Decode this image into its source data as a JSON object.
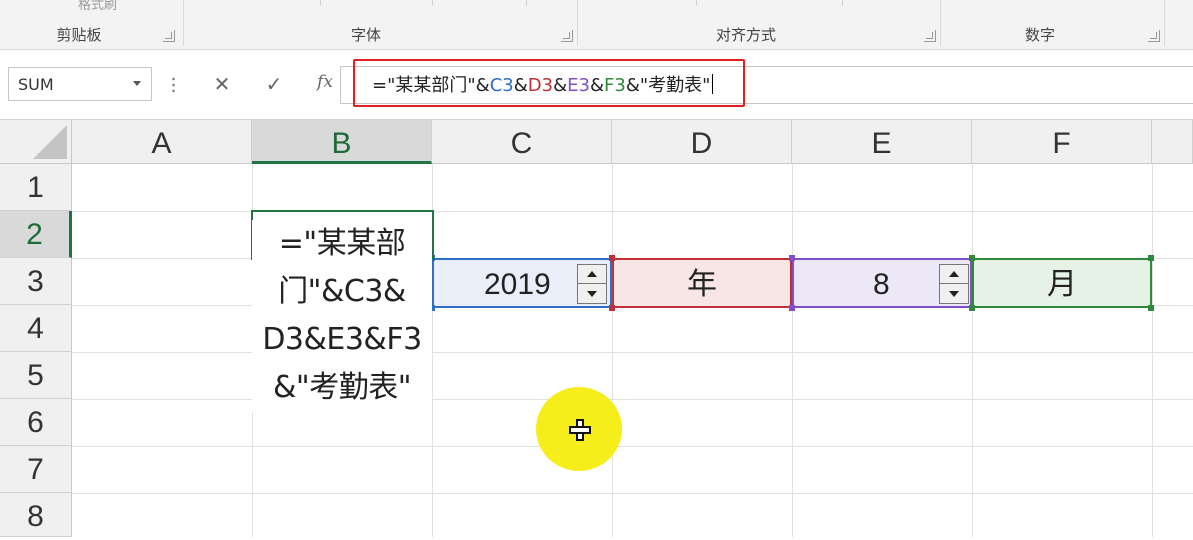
{
  "ribbon": {
    "clipboard_partial": "格式刷",
    "groups": [
      "剪贴板",
      "字体",
      "对齐方式",
      "数字"
    ]
  },
  "formula_bar": {
    "name_box": "SUM",
    "cancel_icon": "close-icon",
    "enter_icon": "checkmark-icon",
    "fx_label": "fx",
    "formula": {
      "p1": "=\"某某部门\"&",
      "c3": "C3",
      "amp1": "&",
      "d3": "D3",
      "amp2": "&",
      "e3": "E3",
      "amp3": "&",
      "f3": "F3",
      "p2": "&\"考勤表\""
    }
  },
  "grid": {
    "columns": [
      "A",
      "B",
      "C",
      "D",
      "E",
      "F"
    ],
    "rows": [
      "1",
      "2",
      "3",
      "4",
      "5",
      "6",
      "7",
      "8"
    ],
    "active_column": "B",
    "active_row": "2",
    "edit_cell_lines": [
      "=\"某某部",
      "门\"&C3&",
      "D3&E3&F3",
      "&\"考勤表\""
    ],
    "cells": {
      "C3": "2019",
      "D3": "年",
      "E3": "8",
      "F3": "月"
    },
    "ref_colors": {
      "C3": "#2e6fc7",
      "D3": "#c0303a",
      "E3": "#8050c8",
      "F3": "#2e8a3a"
    }
  }
}
